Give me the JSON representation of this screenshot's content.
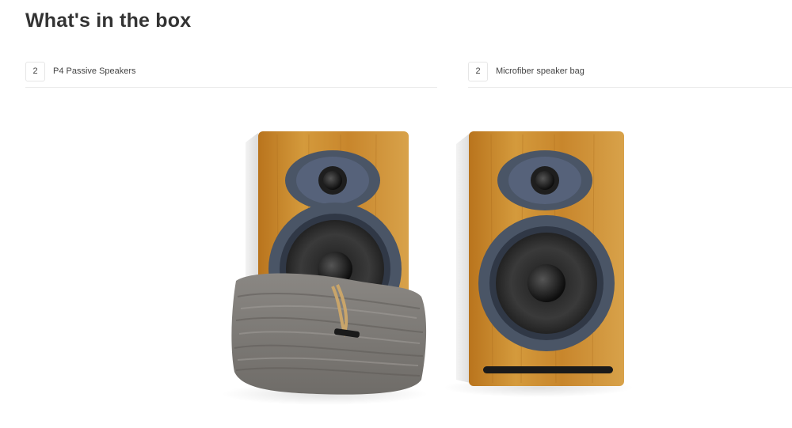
{
  "section": {
    "title": "What's in the box"
  },
  "items": [
    {
      "qty": "2",
      "label": "P4 Passive Speakers"
    },
    {
      "qty": "2",
      "label": "Microfiber speaker bag"
    }
  ],
  "photo": {
    "icon": "speakers-photo"
  },
  "colors": {
    "bamboo": "#c98a2e",
    "driver_ring": "#4a5566",
    "bag": "#7d7a76",
    "text": "#333333"
  }
}
